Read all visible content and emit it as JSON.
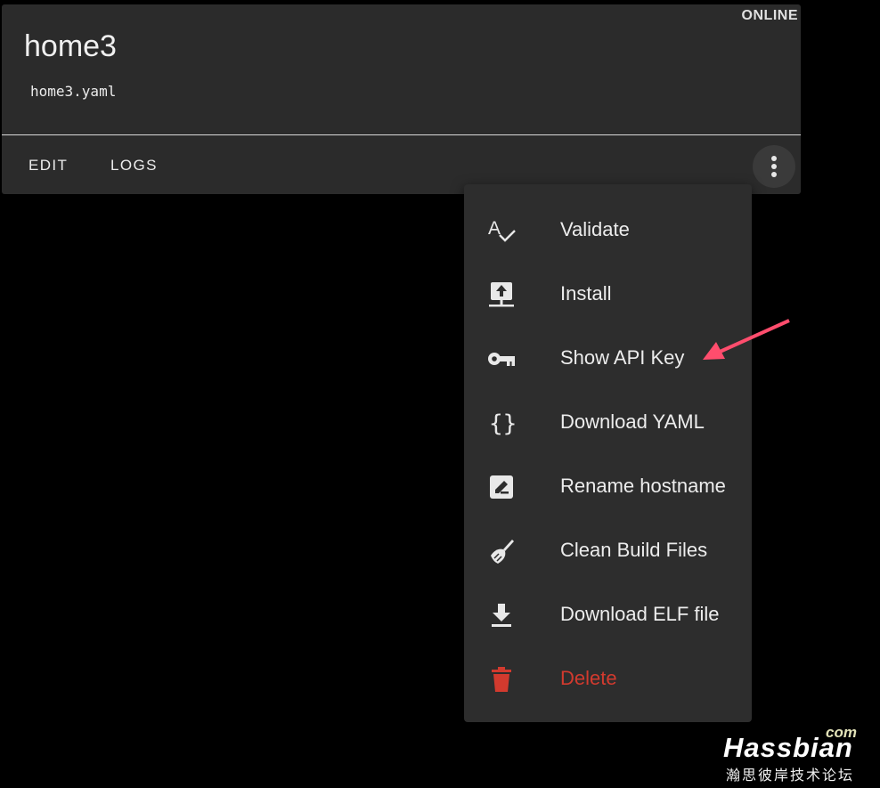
{
  "card": {
    "title": "home3",
    "file": "home3.yaml",
    "status": "ONLINE",
    "actions": {
      "edit": "EDIT",
      "logs": "LOGS"
    }
  },
  "menu": {
    "items": [
      {
        "label": "Validate",
        "icon": "validate-icon"
      },
      {
        "label": "Install",
        "icon": "install-upload-icon"
      },
      {
        "label": "Show API Key",
        "icon": "key-icon"
      },
      {
        "label": "Download YAML",
        "icon": "code-braces-icon"
      },
      {
        "label": "Rename hostname",
        "icon": "rename-icon"
      },
      {
        "label": "Clean Build Files",
        "icon": "broom-icon"
      },
      {
        "label": "Download ELF file",
        "icon": "download-icon"
      },
      {
        "label": "Delete",
        "icon": "delete-icon"
      }
    ]
  },
  "watermark": {
    "com": "com",
    "brand": "Hassbian",
    "subtitle": "瀚思彼岸技术论坛"
  },
  "colors": {
    "danger": "#d23a2e",
    "annotation_arrow": "#ff4d6d",
    "card": "#2b2b2b",
    "menu": "#2d2d2d"
  }
}
